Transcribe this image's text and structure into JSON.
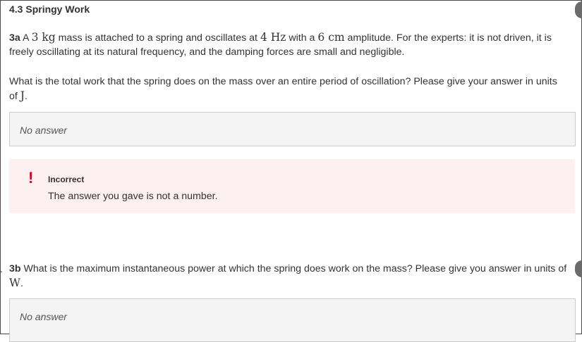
{
  "section": {
    "title": "4.3 Springy Work"
  },
  "question_3a": {
    "id": "3a",
    "text_part1": "A ",
    "mass_value": "3",
    "mass_unit": "kg",
    "text_part2": " mass is attached to a spring and oscillates at ",
    "freq_value": "4",
    "freq_unit": "Hz",
    "text_part3": " with a ",
    "amp_value": "6",
    "amp_unit": "cm",
    "text_part4": " amplitude. For the experts: it is not driven, it is freely oscillating at its natural frequency, and the damping forces are small and negligible.",
    "prompt_part1": "What is the total work that the spring does on the mass over an entire period of oscillation? Please give your answer in units of ",
    "prompt_unit": "J",
    "prompt_end": ".",
    "answer_placeholder": "No answer",
    "feedback": {
      "icon": "!",
      "title": "Incorrect",
      "message": "The answer you gave is not a number."
    }
  },
  "question_3b": {
    "id": "3b",
    "prompt_part1": " What is the maximum instantaneous power at which the spring does work on the mass? Please give you answer in units of ",
    "prompt_unit": "W",
    "prompt_end": ".",
    "answer_placeholder": "No answer"
  },
  "colors": {
    "error": "#e0001b",
    "feedback_bg": "#fdf0f0",
    "answer_bg": "#f4f4f4"
  }
}
